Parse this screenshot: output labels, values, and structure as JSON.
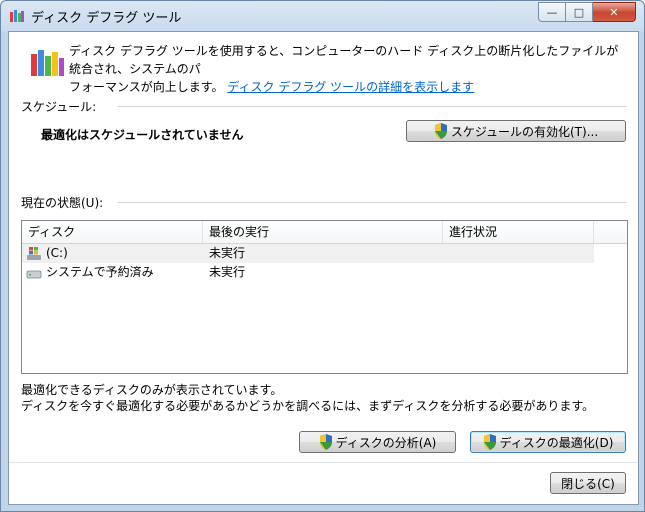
{
  "window": {
    "title": "ディスク デフラグ ツール",
    "caption_buttons": {
      "minimize": "—",
      "maximize": "□",
      "close": "✕"
    }
  },
  "intro": {
    "line1": "ディスク デフラグ ツールを使用すると、コンピューターのハード ディスク上の断片化したファイルが統合され、システムのパ",
    "line2": "フォーマンスが向上します。",
    "link": "ディスク デフラグ ツールの詳細を表示します"
  },
  "schedule": {
    "label": "スケジュール:",
    "status": "最適化はスケジュールされていません",
    "button": "スケジュールの有効化(T)..."
  },
  "current_status": {
    "label": "現在の状態(U):",
    "columns": [
      "ディスク",
      "最後の実行",
      "進行状況"
    ],
    "rows": [
      {
        "disk": "(C:)",
        "last_run": "未実行",
        "progress": "",
        "icon": "windows-drive-icon",
        "selected": true
      },
      {
        "disk": "システムで予約済み",
        "last_run": "未実行",
        "progress": "",
        "icon": "hard-drive-icon",
        "selected": false
      }
    ]
  },
  "footnote": {
    "line1": "最適化できるディスクのみが表示されています。",
    "line2": "ディスクを今すぐ最適化する必要があるかどうかを調べるには、まずディスクを分析する必要があります。"
  },
  "actions": {
    "analyze": "ディスクの分析(A)",
    "defragment": "ディスクの最適化(D)",
    "close": "閉じる(C)"
  },
  "colors": {
    "link": "#0066cc",
    "accent": "#3c7fb1"
  }
}
